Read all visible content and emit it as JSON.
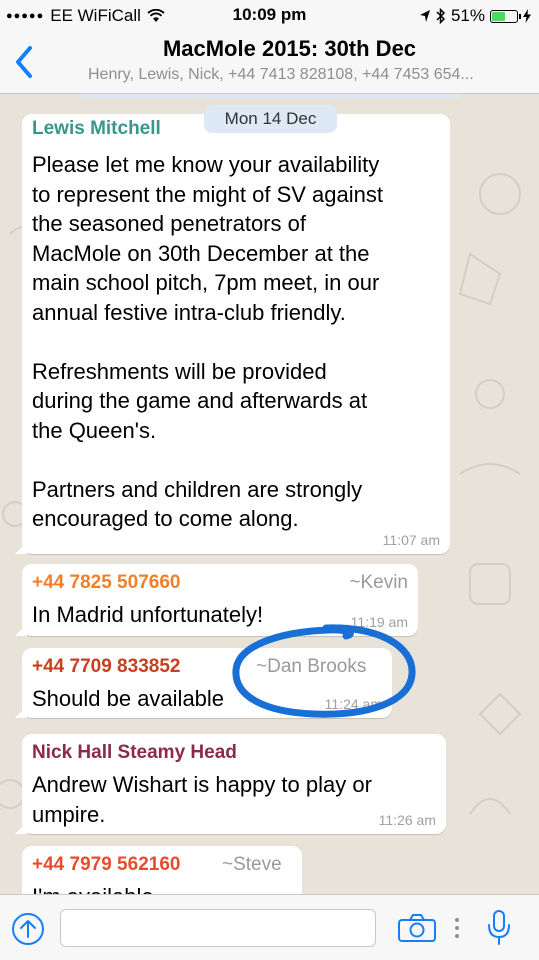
{
  "status": {
    "carrier": "EE WiFiCall",
    "time": "10:09 pm",
    "battery": "51%",
    "battery_level": 0.51
  },
  "header": {
    "back_icon": "chevron-left-icon",
    "title": "MacMole 2015: 30th Dec",
    "subtitle": "Henry, Lewis, Nick, +44 7413 828108, +44 7453 654..."
  },
  "chat": {
    "date_label": "Mon 14 Dec",
    "messages": [
      {
        "sender": "Lewis Mitchell",
        "text": "Please let me know your availability\nto represent the might of SV against\nthe seasoned penetrators of\nMacMole on 30th December at the\nmain school pitch, 7pm meet, in our\nannual festive intra-club friendly.\n\nRefreshments will be provided\nduring the game and afterwards at\nthe Queen's.\n\nPartners and children are strongly\nencouraged to come along.",
        "time": "11:07 am"
      },
      {
        "sender": "+44 7825 507660",
        "tag": "~Kevin",
        "text": "In Madrid unfortunately!",
        "time": "11:19 am"
      },
      {
        "sender": "+44 7709 833852",
        "tag": "~Dan Brooks",
        "text": "Should be available",
        "time": "11:24 am"
      },
      {
        "sender": "Nick Hall Steamy Head",
        "text": "Andrew Wishart is happy to play or\numpire.",
        "time": "11:26 am"
      },
      {
        "sender": "+44 7979 562160",
        "tag": "~Steve",
        "text": "I'm available"
      }
    ]
  },
  "annotation": {
    "color": "#1a6fd6"
  },
  "input_bar": {
    "upload_icon": "arrow-up-circle-icon",
    "text_value": "",
    "camera_icon": "camera-icon",
    "more_icon": "more-vertical-icon",
    "mic_icon": "microphone-icon"
  },
  "colors": {
    "accent": "#147efb"
  }
}
